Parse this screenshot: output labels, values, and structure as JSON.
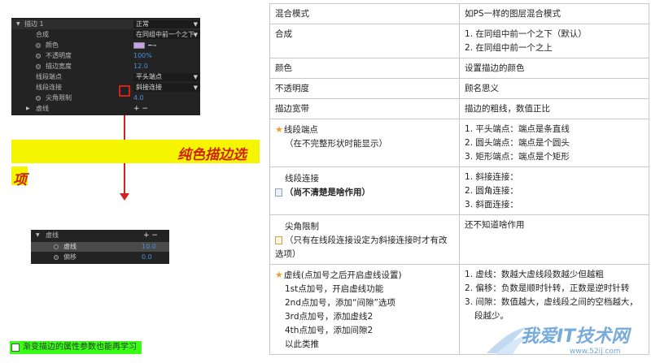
{
  "ae_panel": {
    "rows": [
      {
        "label": "描边 1",
        "value": "正常",
        "kind": "dropdown"
      },
      {
        "label": "合成",
        "value": "在同组中前一个之下",
        "kind": "dropdown"
      },
      {
        "label": "颜色",
        "value": "",
        "kind": "color"
      },
      {
        "label": "不透明度",
        "value": "100%",
        "kind": "blue"
      },
      {
        "label": "描边宽度",
        "value": "12.0",
        "kind": "blue"
      },
      {
        "label": "线段端点",
        "value": "平头端点",
        "kind": "dropdown"
      },
      {
        "label": "线段连接",
        "value": "斜接连接",
        "kind": "dropdown"
      },
      {
        "label": "尖角限制",
        "value": "4.0",
        "kind": "blue"
      },
      {
        "label": "虚线",
        "value": "+ −",
        "kind": "plusminus"
      }
    ],
    "color_swatch": "#c8a0e8"
  },
  "yellow_note": {
    "line1": "纯色描边选",
    "line2": "项"
  },
  "ae_panel2": {
    "rows": [
      {
        "label": "虚线",
        "value": "+ −"
      },
      {
        "label": "虚线",
        "value": "10.0"
      },
      {
        "label": "偏移",
        "value": "0.0"
      }
    ]
  },
  "green_note": "渐变描边的属性参数也能再学习",
  "table": {
    "rows": [
      {
        "left": "混合模式",
        "right": [
          "如PS一样的图层混合模式"
        ]
      },
      {
        "left": "合成",
        "right": [
          "1. 在同组中前一个之下（默认）",
          "2. 在同组中前一个之上"
        ]
      },
      {
        "left": "颜色",
        "right": [
          "设置描边的颜色"
        ]
      },
      {
        "left": "不透明度",
        "right": [
          "顾名思义"
        ]
      },
      {
        "left": "描边宽带",
        "right": [
          "描边的粗线，数值正比"
        ]
      },
      {
        "left": "线段端点",
        "left_sub": "（在不完整形状时能显示）",
        "right": [
          "1. 平头端点：端点是条直线",
          "2. 圆头端点：端点是个圆头",
          "3. 矩形端点：端点是个矩形"
        ]
      },
      {
        "left": "线段连接",
        "left_sub": "（尚不清楚是啥作用）",
        "right": [
          "1. 斜接连接：",
          "2. 圆角连接：",
          "3. 斜面连接："
        ]
      },
      {
        "left": "尖角限制",
        "left_sub": "（只有在线段连接设定为斜接连接时才有改选项）",
        "right": [
          "还不知道啥作用"
        ]
      },
      {
        "left": "虚线(点加号之后开启虚线设置)",
        "left_lines": [
          "1st点加号，开启虚线功能",
          "2nd点加号，添加“间隙”选项",
          "3rd点加号，添加虚线2",
          "4th点加号，添加间隙2",
          "以此类推"
        ],
        "right": [
          "1. 虚线：数越大虚线段数越少但越粗",
          "2. 偏移：负数是顺时针转，正数是逆时针转",
          "3. 间隙：数值越大，虚线段之间的空档越大，",
          "段越少。"
        ]
      }
    ]
  },
  "watermark": {
    "text": "我爱IT技术网",
    "url": "www.52ij.com"
  },
  "colors": {
    "highlight_red": "#d42020",
    "yellow": "#f5f500",
    "green": "#39ff14",
    "star": "#f0a030"
  }
}
